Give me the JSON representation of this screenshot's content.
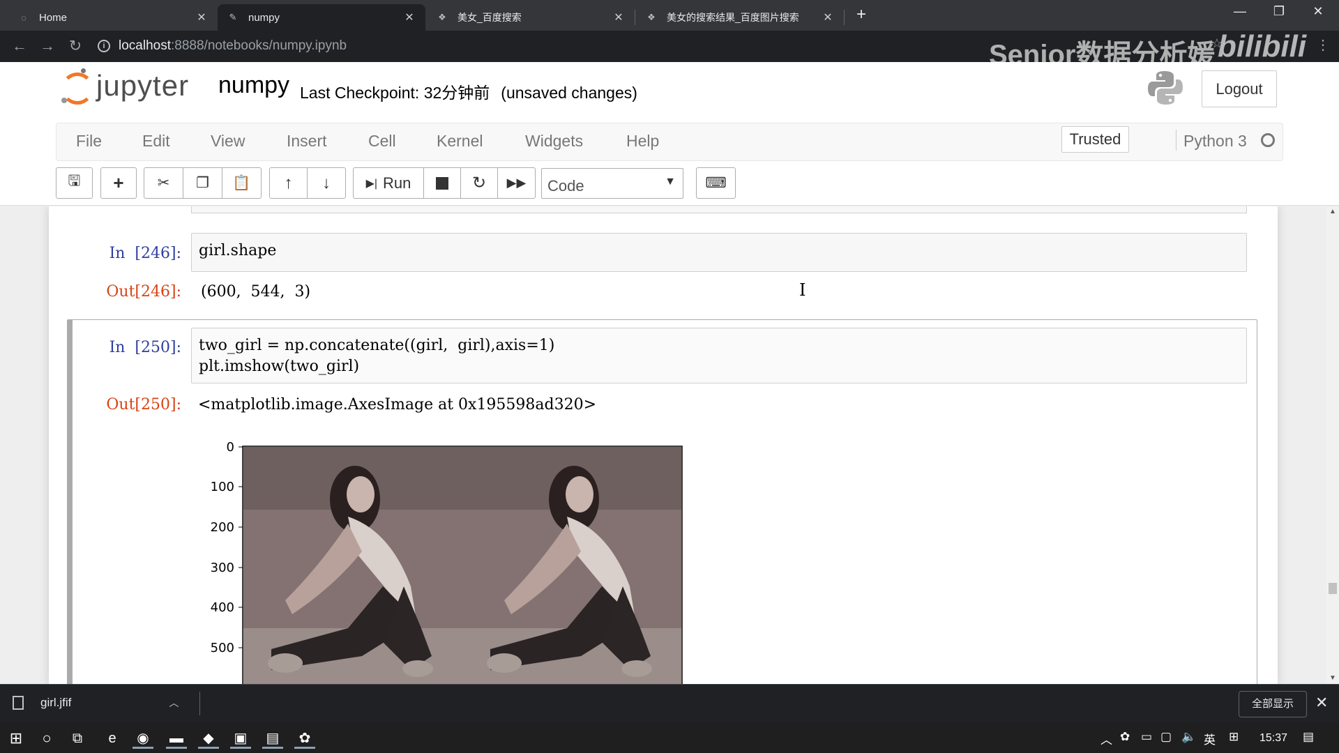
{
  "browser": {
    "tabs": [
      {
        "label": "Home",
        "icon": "loading-icon"
      },
      {
        "label": "numpy",
        "icon": "notebook-icon"
      },
      {
        "label": "美女_百度搜索",
        "icon": "baidu-icon"
      },
      {
        "label": "美女的搜索结果_百度图片搜索",
        "icon": "baidu-icon"
      }
    ],
    "url_host": "localhost",
    "url_path": ":8888/notebooks/numpy.ipynb",
    "watermark": "Senior数据分析媛",
    "watermark_logo": "bilibili"
  },
  "jupyter": {
    "logo_text": "jupyter",
    "notebook_name": "numpy",
    "checkpoint": "Last Checkpoint: 32分钟前",
    "unsaved": "(unsaved changes)",
    "logout": "Logout",
    "menu": [
      "File",
      "Edit",
      "View",
      "Insert",
      "Cell",
      "Kernel",
      "Widgets",
      "Help"
    ],
    "trusted": "Trusted",
    "kernel": "Python 3",
    "run_label": "Run",
    "cell_type": "Code"
  },
  "cells": [
    {
      "in_prompt": "In  [246]:",
      "code": [
        "girl.shape"
      ],
      "out_prompt": "Out[246]:",
      "output": "(600,  544,  3)"
    },
    {
      "in_prompt": "In  [250]:",
      "code": [
        "two_girl = np.concatenate((girl,  girl),axis=1)",
        "plt.imshow(two_girl)"
      ],
      "out_prompt": "Out[250]:",
      "output": "<matplotlib.image.AxesImage at 0x195598ad320>"
    }
  ],
  "plot": {
    "yticks": [
      "0",
      "100",
      "200",
      "300",
      "400",
      "500"
    ]
  },
  "download": {
    "filename": "girl.jfif",
    "show_all": "全部显示"
  },
  "taskbar": {
    "ime": "英",
    "time": "15:37"
  }
}
